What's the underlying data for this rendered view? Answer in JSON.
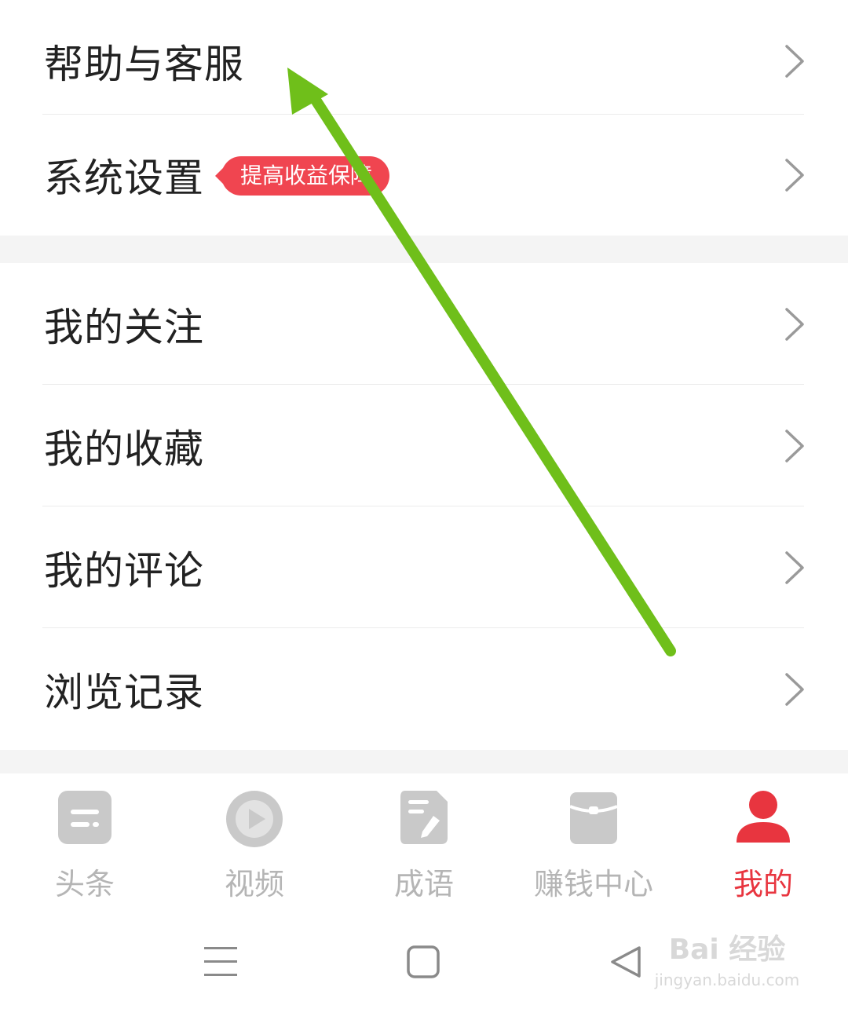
{
  "menu_group_1": {
    "items": [
      {
        "label": "帮助与客服"
      },
      {
        "label": "系统设置",
        "badge": "提高收益保障"
      }
    ]
  },
  "menu_group_2": {
    "items": [
      {
        "label": "我的关注"
      },
      {
        "label": "我的收藏"
      },
      {
        "label": "我的评论"
      },
      {
        "label": "浏览记录"
      }
    ]
  },
  "tabbar": {
    "tabs": [
      {
        "label": "头条",
        "icon": "news-icon"
      },
      {
        "label": "视频",
        "icon": "play-icon"
      },
      {
        "label": "成语",
        "icon": "notepad-icon"
      },
      {
        "label": "赚钱中心",
        "icon": "wallet-icon"
      },
      {
        "label": "我的",
        "icon": "person-icon",
        "active": true
      }
    ]
  },
  "watermark": {
    "brand": "Bai 经验",
    "url": "jingyan.baidu.com"
  },
  "colors": {
    "accent": "#e8353f",
    "badge": "#f04550",
    "inactive": "#b5b5b5",
    "annotation_arrow": "#6fbf1a"
  }
}
